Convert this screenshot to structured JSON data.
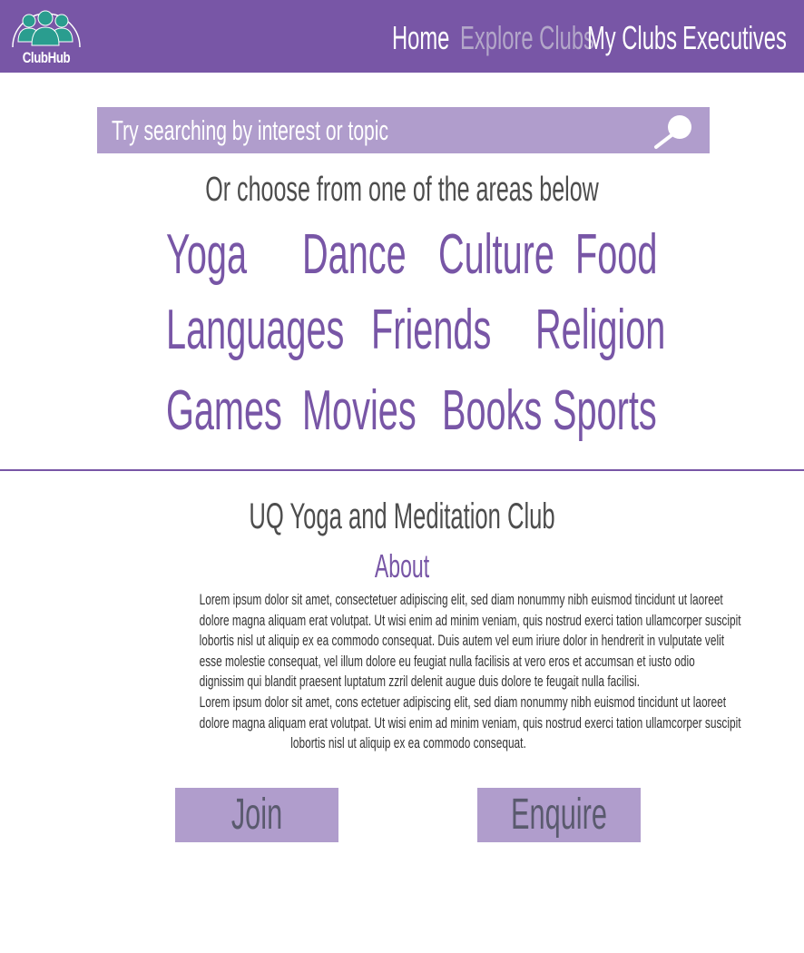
{
  "colors": {
    "primary": "#7856a6",
    "light_purple": "#b09dcc",
    "nav_active": "#b3a7c9",
    "logo_teal": "#2a9d8f",
    "text_grey": "#4d4d4d"
  },
  "header": {
    "logo_text": "ClubHub",
    "logo_icon": "people-group-icon",
    "nav": {
      "home": "Home",
      "explore": "Explore Clubs",
      "my_clubs": "My Clubs",
      "executives": "Executives"
    },
    "active_nav": "Explore Clubs"
  },
  "search": {
    "placeholder": "Try searching by interest or topic",
    "button_icon": "search-icon"
  },
  "subtitle": "Or choose from one of the areas below",
  "categories": [
    "Yoga",
    "Dance",
    "Culture",
    "Food",
    "Languages",
    "Friends",
    "Religion",
    "Games",
    "Movies",
    "Books",
    "Sports"
  ],
  "club": {
    "title": "UQ Yoga and Meditation Club",
    "about_heading": "About",
    "about_lines": [
      "Lorem ipsum dolor sit amet, consectetuer adipiscing elit, sed diam nonummy nibh euismod tincidunt ut laoreet",
      "dolore magna aliquam erat volutpat. Ut wisi enim ad minim veniam, quis nostrud exerci tation ullamcorper suscipit",
      "lobortis nisl ut aliquip ex ea commodo consequat. Duis autem vel eum iriure dolor in hendrerit in vulputate velit",
      "esse molestie consequat, vel illum dolore eu feugiat nulla facilisis at vero eros et accumsan et iusto odio",
      "dignissim qui blandit praesent luptatum zzril delenit augue duis dolore te feugait nulla facilisi.",
      "Lorem ipsum dolor sit amet, cons ectetuer adipiscing elit, sed diam nonummy nibh euismod tincidunt ut laoreet",
      "dolore magna aliquam erat volutpat. Ut wisi enim ad minim veniam, quis nostrud exerci tation ullamcorper suscipit",
      "lobortis nisl ut aliquip ex ea commodo consequat."
    ]
  },
  "buttons": {
    "join": "Join",
    "enquire": "Enquire"
  }
}
